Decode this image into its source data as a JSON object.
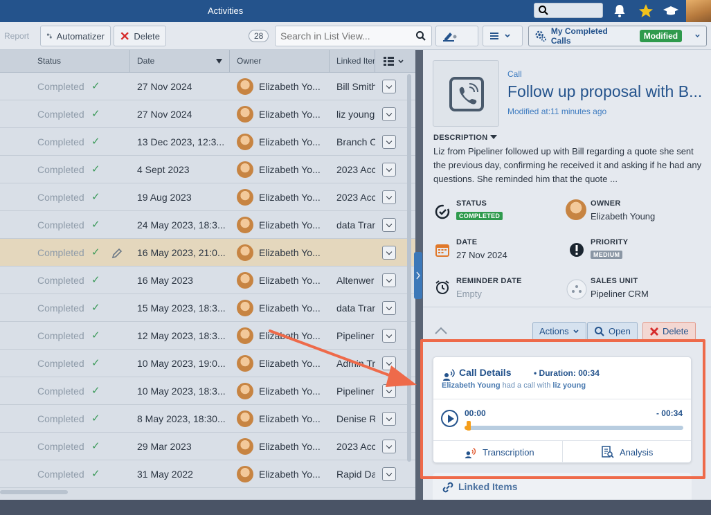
{
  "topbar": {
    "title": "Activities"
  },
  "toolbar": {
    "report_label": "Report",
    "automatizer_label": "Automatizer",
    "delete_label": "Delete",
    "count": "28",
    "search_placeholder": "Search in List View...",
    "view_label": "My Completed Calls",
    "modified_label": "Modified"
  },
  "list": {
    "headers": {
      "status": "Status",
      "date": "Date",
      "owner": "Owner",
      "linked": "Linked Iter"
    },
    "rows": [
      {
        "status": "Completed",
        "date": "27 Nov 2024",
        "owner": "Elizabeth Yo...",
        "linked": "Bill Smith"
      },
      {
        "status": "Completed",
        "date": "27 Nov 2024",
        "owner": "Elizabeth Yo...",
        "linked": "liz young"
      },
      {
        "status": "Completed",
        "date": "13 Dec 2023, 12:3...",
        "owner": "Elizabeth Yo...",
        "linked": "Branch O"
      },
      {
        "status": "Completed",
        "date": "4 Sept 2023",
        "owner": "Elizabeth Yo...",
        "linked": "2023 Acc"
      },
      {
        "status": "Completed",
        "date": "19 Aug 2023",
        "owner": "Elizabeth Yo...",
        "linked": "2023 Acc"
      },
      {
        "status": "Completed",
        "date": "24 May 2023, 18:3...",
        "owner": "Elizabeth Yo...",
        "linked": "data Tran"
      },
      {
        "status": "Completed",
        "date": "16 May 2023, 21:0...",
        "owner": "Elizabeth Yo...",
        "linked": ""
      },
      {
        "status": "Completed",
        "date": "16 May 2023",
        "owner": "Elizabeth Yo...",
        "linked": "Altenwer"
      },
      {
        "status": "Completed",
        "date": "15 May 2023, 18:3...",
        "owner": "Elizabeth Yo...",
        "linked": "data Tran"
      },
      {
        "status": "Completed",
        "date": "12 May 2023, 18:3...",
        "owner": "Elizabeth Yo...",
        "linked": "Pipeliner"
      },
      {
        "status": "Completed",
        "date": "10 May 2023, 19:0...",
        "owner": "Elizabeth Yo...",
        "linked": "Admin Tr"
      },
      {
        "status": "Completed",
        "date": "10 May 2023, 18:3...",
        "owner": "Elizabeth Yo...",
        "linked": "Pipeliner"
      },
      {
        "status": "Completed",
        "date": "8 May 2023, 18:30...",
        "owner": "Elizabeth Yo...",
        "linked": "Denise R"
      },
      {
        "status": "Completed",
        "date": "29 Mar 2023",
        "owner": "Elizabeth Yo...",
        "linked": "2023 Acc"
      },
      {
        "status": "Completed",
        "date": "31 May 2022",
        "owner": "Elizabeth Yo...",
        "linked": "Rapid Da"
      }
    ]
  },
  "detail": {
    "type": "Call",
    "title": "Follow up proposal with B...",
    "modified": "Modified at:11 minutes ago",
    "description_label": "DESCRIPTION",
    "description": "Liz from Pipeliner followed up with Bill regarding a quote she sent the previous day, confirming he received it and asking if he had any questions. She reminded him that the quote ...",
    "status_label": "STATUS",
    "status_value": "COMPLETED",
    "owner_label": "OWNER",
    "owner_value": "Elizabeth Young",
    "date_label": "DATE",
    "date_value": "27 Nov 2024",
    "priority_label": "PRIORITY",
    "priority_value": "MEDIUM",
    "reminder_label": "REMINDER DATE",
    "reminder_value": "Empty",
    "sales_unit_label": "SALES UNIT",
    "sales_unit_value": "Pipeliner CRM",
    "actions_label": "Actions",
    "open_label": "Open",
    "delete_label": "Delete"
  },
  "call_card": {
    "title": "Call Details",
    "duration": "• Duration: 00:34",
    "caller": "Elizabeth Young",
    "had_call_with": "had a call with",
    "callee": "liz young",
    "time_start": "00:00",
    "time_end": "- 00:34",
    "progress": 0.02,
    "transcription_label": "Transcription",
    "analysis_label": "Analysis"
  },
  "linked_items": {
    "title": "Linked Items"
  },
  "colors": {
    "brand": "#24538c",
    "accent": "#ee6a4a",
    "success": "#2f9a4d",
    "progress": "#f59e1b"
  }
}
